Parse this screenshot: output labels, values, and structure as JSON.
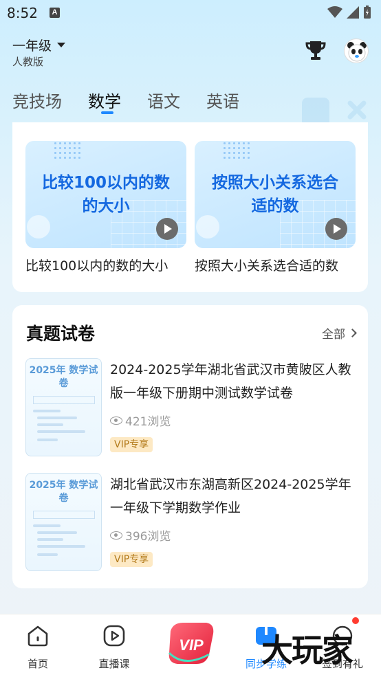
{
  "status_bar": {
    "time": "8:52",
    "notification": "A"
  },
  "header": {
    "grade": "一年级",
    "edition": "人教版"
  },
  "tabs": [
    {
      "label": "竞技场"
    },
    {
      "label": "数学"
    },
    {
      "label": "语文"
    },
    {
      "label": "英语"
    }
  ],
  "active_tab": "数学",
  "courses": [
    {
      "thumb_title": "比较100以内的数的大小",
      "caption": "比较100以内的数的大小"
    },
    {
      "thumb_title": "按照大小关系选合适的数",
      "caption": "按照大小关系选合适的数"
    }
  ],
  "exams": {
    "title": "真题试卷",
    "see_all": "全部",
    "items": [
      {
        "thumb_title": "2025年 数学试卷",
        "title": "2024-2025学年湖北省武汉市黄陂区人教版一年级下册期中测试数学试卷",
        "views": "421浏览",
        "badge": "VIP专享"
      },
      {
        "thumb_title": "2025年 数学试卷",
        "title": "湖北省武汉市东湖高新区2024-2025学年一年级下学期数学作业",
        "views": "396浏览",
        "badge": "VIP专享"
      }
    ]
  },
  "bottom_nav": [
    {
      "label": "首页"
    },
    {
      "label": "直播课"
    },
    {
      "label": "VIP"
    },
    {
      "label": "同步学练"
    },
    {
      "label": "签到有礼"
    }
  ],
  "watermark": "大玩家",
  "colors": {
    "accent": "#1e88ff",
    "vip_badge_bg": "#fde9c4",
    "vip_badge_text": "#b37a1a"
  }
}
